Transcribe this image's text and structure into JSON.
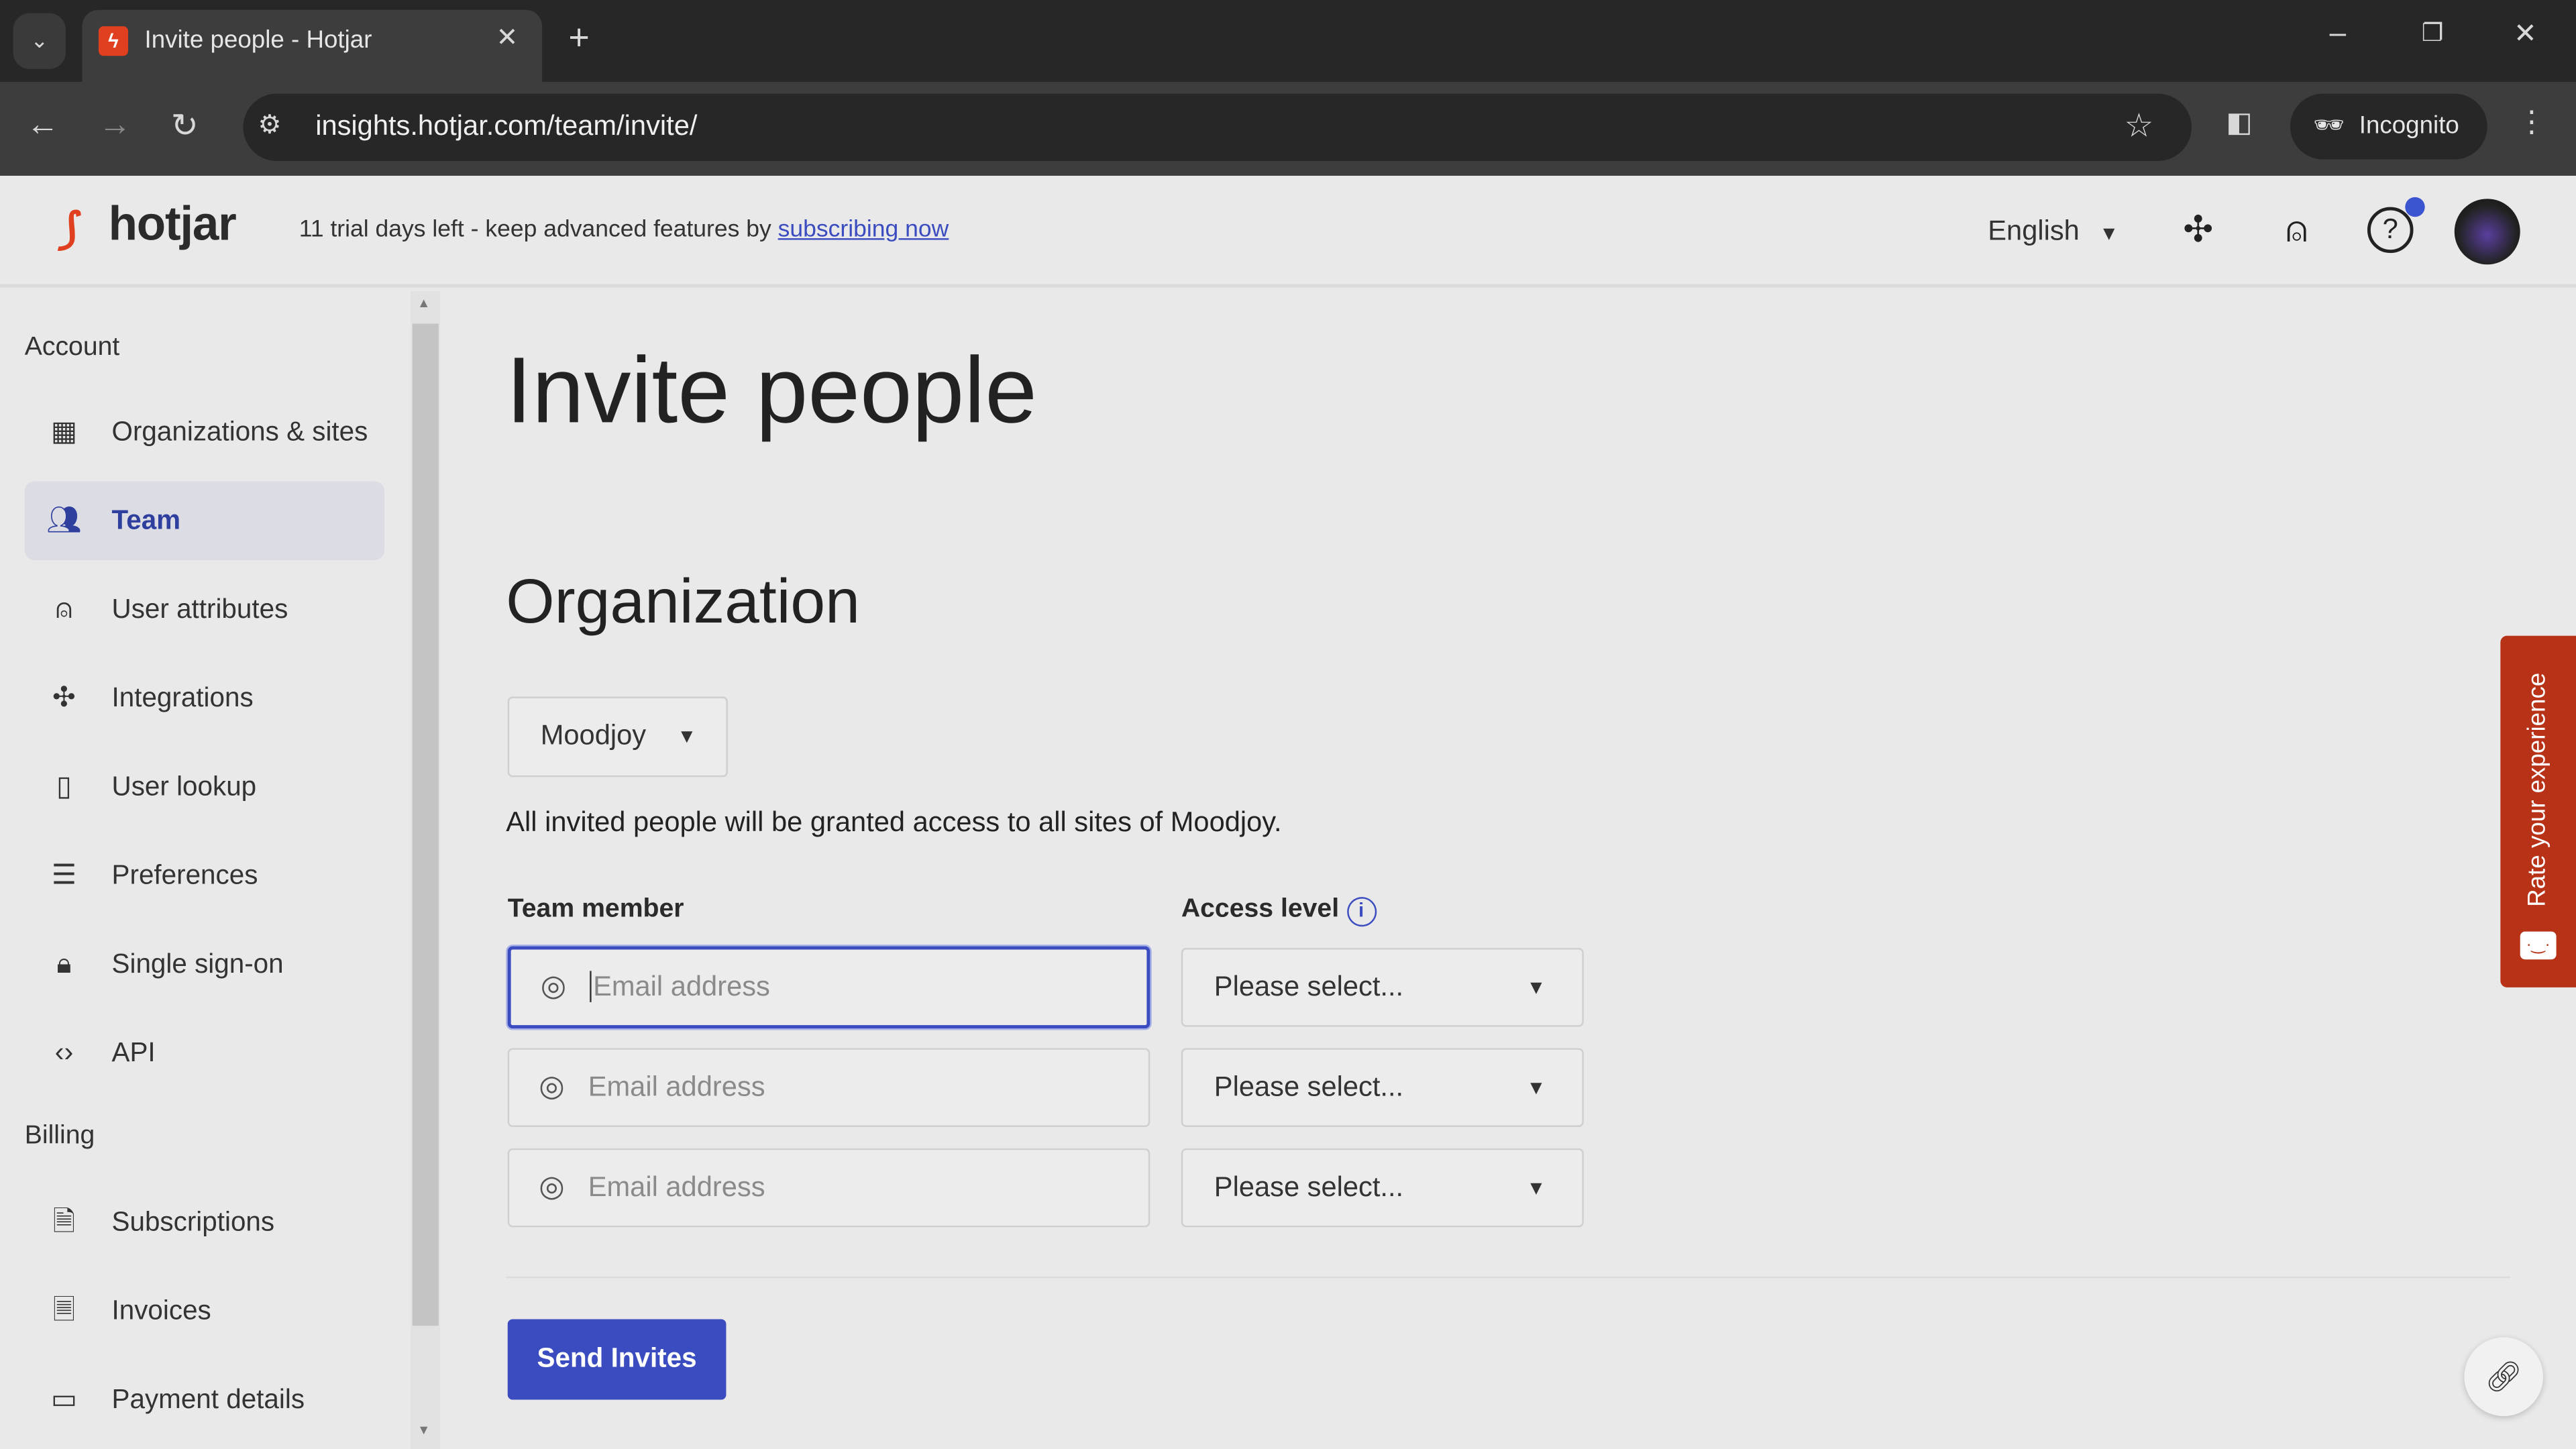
{
  "browser": {
    "tab_title": "Invite people - Hotjar",
    "url": "insights.hotjar.com/team/invite/",
    "incognito_label": "Incognito"
  },
  "header": {
    "logo": "hotjar",
    "trial_text": "11 trial days left - keep advanced features by ",
    "trial_link": "subscribing now",
    "language": "English"
  },
  "sidebar": {
    "account_heading": "Account",
    "items": [
      {
        "label": "Organizations & sites",
        "icon": "building-icon"
      },
      {
        "label": "Team",
        "icon": "team-icon",
        "active": true
      },
      {
        "label": "User attributes",
        "icon": "user-attributes-icon"
      },
      {
        "label": "Integrations",
        "icon": "puzzle-icon"
      },
      {
        "label": "User lookup",
        "icon": "user-lookup-icon"
      },
      {
        "label": "Preferences",
        "icon": "sliders-icon"
      },
      {
        "label": "Single sign-on",
        "icon": "lock-icon"
      },
      {
        "label": "API",
        "icon": "code-icon"
      }
    ],
    "billing_heading": "Billing",
    "billing_items": [
      {
        "label": "Subscriptions",
        "icon": "subscriptions-icon"
      },
      {
        "label": "Invoices",
        "icon": "invoice-icon"
      },
      {
        "label": "Payment details",
        "icon": "credit-card-icon"
      }
    ]
  },
  "main": {
    "title": "Invite people",
    "org_heading": "Organization",
    "org_select": "Moodjoy",
    "info": "All invited people will be granted access to all sites of Moodjoy.",
    "team_member_label": "Team member",
    "access_level_label": "Access level",
    "rows": [
      {
        "email_placeholder": "Email address",
        "access": "Please select..."
      },
      {
        "email_placeholder": "Email address",
        "access": "Please select..."
      },
      {
        "email_placeholder": "Email address",
        "access": "Please select..."
      }
    ],
    "send_label": "Send Invites"
  },
  "feedback": {
    "label": "Rate your experience"
  },
  "colors": {
    "accent": "#3b4cc0",
    "brand": "#e0401f",
    "feedback": "#b83217"
  }
}
